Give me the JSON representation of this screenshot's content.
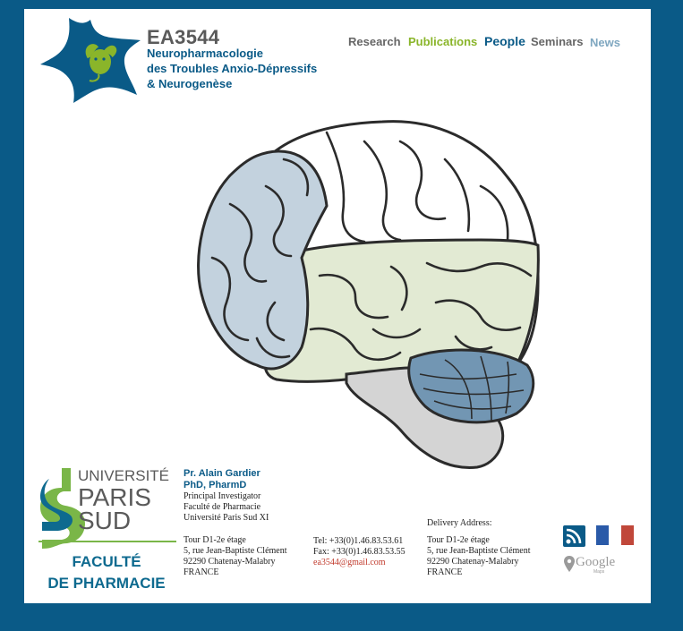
{
  "header": {
    "lab_code": "EA3544",
    "lab_name_lines": [
      "Neuropharmacologie",
      "des Troubles Anxio-Dépressifs",
      "& Neurogenèse"
    ]
  },
  "nav": {
    "items": [
      {
        "label": "Research",
        "color": "#666666"
      },
      {
        "label": "Publications",
        "color": "#8ab52a"
      },
      {
        "label": "People",
        "color": "#0a5a87"
      },
      {
        "label": "Seminars",
        "color": "#666666"
      },
      {
        "label": "News",
        "color": "#7fa7c0"
      }
    ]
  },
  "colors": {
    "frame": "#0a5a87",
    "brain_blue": "#c3d2de",
    "brain_green": "#e2ead3",
    "brain_cerebellum": "#7296b3",
    "brain_stem": "#d4d4d4",
    "univ_green": "#7ab648",
    "univ_blue": "#0e6a8f"
  },
  "university": {
    "line1": "UNIVERSITÉ",
    "line2": "PARIS",
    "line3": "SUD",
    "faculty1": "FACULTÉ",
    "faculty2": "DE PHARMACIE"
  },
  "contact": {
    "pi_line1": "Pr. Alain Gardier",
    "pi_line2": "PhD, PharmD",
    "title": "Principal Investigator",
    "faculty": "Faculté de Pharmacie",
    "university": "Université Paris Sud XI",
    "addr1": "Tour D1-2e étage",
    "addr2": "5, rue Jean-Baptiste Clément",
    "addr3": "92290 Chatenay-Malabry",
    "addr4": "FRANCE",
    "tel": "Tel: +33(0)1.46.83.53.61",
    "fax": "Fax: +33(0)1.46.83.53.55",
    "email": "ea3544@gmail.com",
    "delivery_label": "Delivery Address:",
    "delivery1": "Tour D1-2e étage",
    "delivery2": "5, rue Jean-Baptiste Clément",
    "delivery3": "92290 Chatenay-Malabry",
    "delivery4": "FRANCE"
  },
  "icons": {
    "rss": "rss-icon",
    "flag": "french-flag-icon",
    "maps": "google-maps-icon",
    "google_text": "Google",
    "maps_text": "Maps"
  }
}
